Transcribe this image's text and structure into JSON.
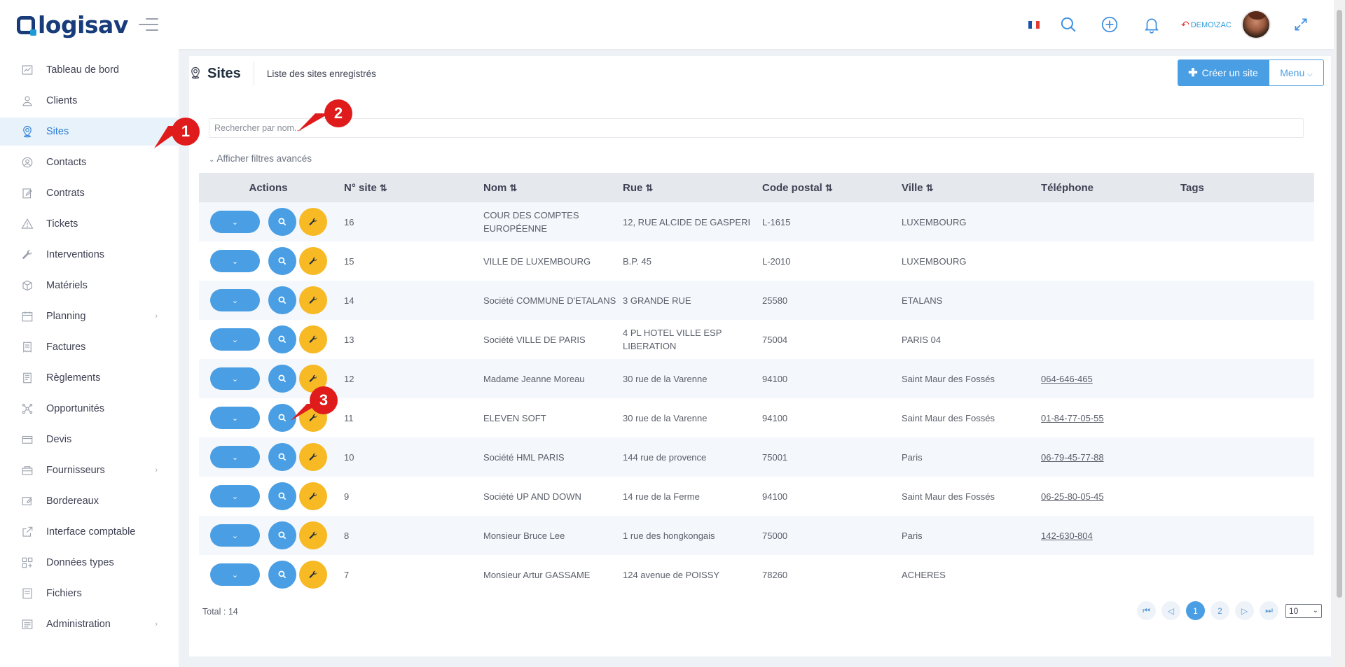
{
  "app": {
    "logo_text": "logisav",
    "user_label": "DEMO\\ZAC"
  },
  "colors": {
    "accent": "#4a9ee3",
    "edit": "#f7b924",
    "annotation": "#e01b1b",
    "brand": "#183c7a"
  },
  "sidebar": {
    "items": [
      {
        "label": "Tableau de bord",
        "icon": "chart-icon"
      },
      {
        "label": "Clients",
        "icon": "user-icon"
      },
      {
        "label": "Sites",
        "icon": "location-pin-icon",
        "active": true
      },
      {
        "label": "Contacts",
        "icon": "contact-icon"
      },
      {
        "label": "Contrats",
        "icon": "contract-icon"
      },
      {
        "label": "Tickets",
        "icon": "warning-icon"
      },
      {
        "label": "Interventions",
        "icon": "wrench-icon"
      },
      {
        "label": "Matériels",
        "icon": "box-icon"
      },
      {
        "label": "Planning",
        "icon": "calendar-icon",
        "has_children": true
      },
      {
        "label": "Factures",
        "icon": "invoice-icon"
      },
      {
        "label": "Règlements",
        "icon": "payment-icon"
      },
      {
        "label": "Opportunités",
        "icon": "network-icon"
      },
      {
        "label": "Devis",
        "icon": "quote-icon"
      },
      {
        "label": "Fournisseurs",
        "icon": "supplier-icon",
        "has_children": true
      },
      {
        "label": "Bordereaux",
        "icon": "slip-icon"
      },
      {
        "label": "Interface comptable",
        "icon": "external-link-icon"
      },
      {
        "label": "Données types",
        "icon": "grid-icon"
      },
      {
        "label": "Fichiers",
        "icon": "folder-icon"
      },
      {
        "label": "Administration",
        "icon": "settings-icon",
        "has_children": true
      }
    ]
  },
  "page": {
    "title": "Sites",
    "subtitle": "Liste des sites enregistrés",
    "create_button": "Créer un site",
    "menu_button": "Menu",
    "search_placeholder": "Rechercher par nom...",
    "filters_toggle": "Afficher filtres avancés",
    "total_label": "Total : 14"
  },
  "table": {
    "headers": {
      "actions": "Actions",
      "num": "N° site",
      "nom": "Nom",
      "rue": "Rue",
      "cp": "Code postal",
      "ville": "Ville",
      "tel": "Téléphone",
      "tags": "Tags"
    },
    "rows": [
      {
        "num": "16",
        "nom": "COUR DES COMPTES EUROPÉENNE",
        "rue": "12, RUE ALCIDE DE GASPERI",
        "cp": "L-1615",
        "ville": "LUXEMBOURG",
        "tel": ""
      },
      {
        "num": "15",
        "nom": "VILLE DE LUXEMBOURG",
        "rue": "B.P. 45",
        "cp": "L-2010",
        "ville": "LUXEMBOURG",
        "tel": ""
      },
      {
        "num": "14",
        "nom": "Société COMMUNE D'ETALANS",
        "rue": "3 GRANDE RUE",
        "cp": "25580",
        "ville": "ETALANS",
        "tel": ""
      },
      {
        "num": "13",
        "nom": "Société VILLE DE PARIS",
        "rue": "4 PL HOTEL VILLE ESP LIBERATION",
        "cp": "75004",
        "ville": "PARIS 04",
        "tel": ""
      },
      {
        "num": "12",
        "nom": "Madame Jeanne Moreau",
        "rue": "30 rue de la Varenne",
        "cp": "94100",
        "ville": "Saint Maur des Fossés",
        "tel": "064-646-465"
      },
      {
        "num": "11",
        "nom": "ELEVEN SOFT",
        "rue": "30 rue de la Varenne",
        "cp": "94100",
        "ville": "Saint Maur des Fossés",
        "tel": "01-84-77-05-55"
      },
      {
        "num": "10",
        "nom": "Société HML PARIS",
        "rue": "144 rue de provence",
        "cp": "75001",
        "ville": "Paris",
        "tel": "06-79-45-77-88"
      },
      {
        "num": "9",
        "nom": "Société UP AND DOWN",
        "rue": "14 rue de la Ferme",
        "cp": "94100",
        "ville": "Saint Maur des Fossés",
        "tel": "06-25-80-05-45"
      },
      {
        "num": "8",
        "nom": "Monsieur Bruce Lee",
        "rue": "1 rue des hongkongais",
        "cp": "75000",
        "ville": "Paris",
        "tel": "142-630-804"
      },
      {
        "num": "7",
        "nom": "Monsieur Artur GASSAME",
        "rue": "124 avenue de POISSY",
        "cp": "78260",
        "ville": "ACHERES",
        "tel": ""
      }
    ]
  },
  "pagination": {
    "pages": [
      "1",
      "2"
    ],
    "current": "1",
    "page_size": "10"
  },
  "annotations": [
    "1",
    "2",
    "3"
  ]
}
